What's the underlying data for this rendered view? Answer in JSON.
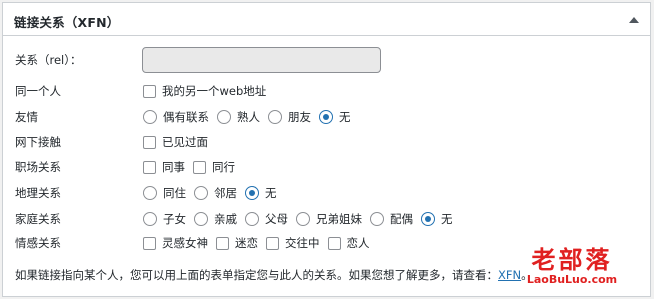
{
  "header": {
    "title": "链接关系（XFN）"
  },
  "rel": {
    "label": "关系（rel）："
  },
  "rows": [
    {
      "label": "同一个人",
      "type": "checkbox",
      "options": [
        {
          "label": "我的另一个web地址",
          "checked": false
        }
      ]
    },
    {
      "label": "友情",
      "type": "radio",
      "options": [
        {
          "label": "偶有联系",
          "checked": false
        },
        {
          "label": "熟人",
          "checked": false
        },
        {
          "label": "朋友",
          "checked": false
        },
        {
          "label": "无",
          "checked": true
        }
      ]
    },
    {
      "label": "网下接触",
      "type": "checkbox",
      "options": [
        {
          "label": "已见过面",
          "checked": false
        }
      ]
    },
    {
      "label": "职场关系",
      "type": "checkbox",
      "options": [
        {
          "label": "同事",
          "checked": false
        },
        {
          "label": "同行",
          "checked": false
        }
      ]
    },
    {
      "label": "地理关系",
      "type": "radio",
      "options": [
        {
          "label": "同住",
          "checked": false
        },
        {
          "label": "邻居",
          "checked": false
        },
        {
          "label": "无",
          "checked": true
        }
      ]
    },
    {
      "label": "家庭关系",
      "type": "radio",
      "options": [
        {
          "label": "子女",
          "checked": false
        },
        {
          "label": "亲戚",
          "checked": false
        },
        {
          "label": "父母",
          "checked": false
        },
        {
          "label": "兄弟姐妹",
          "checked": false
        },
        {
          "label": "配偶",
          "checked": false
        },
        {
          "label": "无",
          "checked": true
        }
      ]
    },
    {
      "label": "情感关系",
      "type": "checkbox",
      "options": [
        {
          "label": "灵感女神",
          "checked": false
        },
        {
          "label": "迷恋",
          "checked": false
        },
        {
          "label": "交往中",
          "checked": false
        },
        {
          "label": "恋人",
          "checked": false
        }
      ]
    }
  ],
  "footer": {
    "text": "如果链接指向某个人，您可以用上面的表单指定您与此人的关系。如果您想了解更多，请查看：",
    "link": "XFN",
    "end": "。"
  },
  "watermark": {
    "big": "老部落",
    "small": "LaoBuLuo.com"
  },
  "colors": {
    "accent": "#2271b1",
    "watermark": "#e02020",
    "border": "#ccd0d4"
  }
}
